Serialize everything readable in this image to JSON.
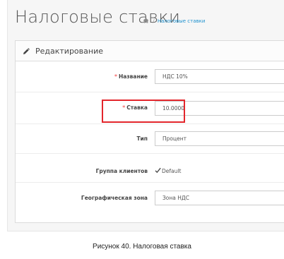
{
  "header": {
    "title": "Налоговые ставки",
    "breadcrumb": [
      {
        "icon": "home-icon"
      },
      {
        "label": "Налоговые ставки"
      }
    ],
    "breadcrumb_separator": "/"
  },
  "panel": {
    "title": "Редактирование",
    "icon": "pencil-icon"
  },
  "form": {
    "name": {
      "label": "Название",
      "required_mark": "*",
      "value": "НДС 10%"
    },
    "rate": {
      "label": "Ставка",
      "required_mark": "*",
      "value": "10.0000"
    },
    "type": {
      "label": "Тип",
      "value": "Процент"
    },
    "customer_group": {
      "label": "Группа клиентов",
      "option": "Default",
      "checked": true
    },
    "geo_zone": {
      "label": "Географическая зона",
      "value": "Зона НДС"
    }
  },
  "colors": {
    "accent": "#1e91cf",
    "highlight": "#e3262c",
    "required": "#f56b6b"
  },
  "caption": "Рисунок 40. Налоговая ставка"
}
